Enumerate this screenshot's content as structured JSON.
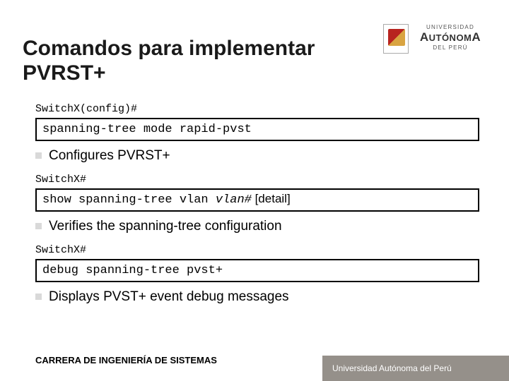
{
  "title": "Comandos para implementar\nPVRST+",
  "logo": {
    "univ": "UNIVERSIDAD",
    "auto_prefix": "A",
    "auto_mid": "UTÓNOM",
    "auto_suffix": "A",
    "peru": "DEL PERÚ"
  },
  "sections": [
    {
      "prompt": "SwitchX(config)#",
      "command": "spanning-tree mode rapid-pvst",
      "arg": "",
      "opt": "",
      "bullet": "Configures PVRST+"
    },
    {
      "prompt": "SwitchX#",
      "command": "show spanning-tree vlan ",
      "arg": "vlan#",
      "opt": " [detail]",
      "bullet": "Verifies the spanning-tree configuration"
    },
    {
      "prompt": "SwitchX#",
      "command": "debug spanning-tree pvst+",
      "arg": "",
      "opt": "",
      "bullet": "Displays PVST+ event debug messages"
    }
  ],
  "footer_left": "CARRERA DE INGENIERÍA DE SISTEMAS",
  "footer_band": "Universidad Autónoma del Perú"
}
